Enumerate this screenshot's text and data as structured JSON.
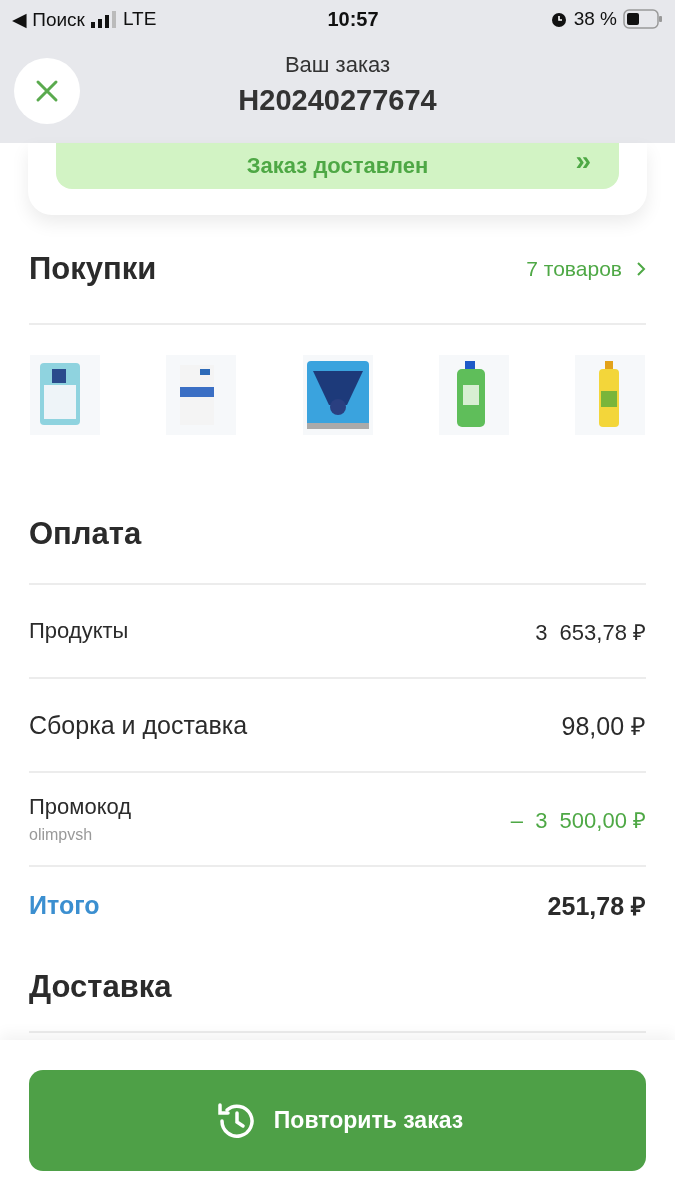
{
  "status_bar": {
    "back_label": "◀ Поиск",
    "network": "LTE",
    "time": "10:57",
    "battery": "38 %"
  },
  "header": {
    "title": "Ваш заказ",
    "order_number": "H20240277674"
  },
  "order_status": {
    "label": "Заказ доставлен",
    "arrow": "»"
  },
  "purchases": {
    "title": "Покупки",
    "count_link": "7 товаров",
    "products": [
      {
        "kind": "bag"
      },
      {
        "kind": "box"
      },
      {
        "kind": "can"
      },
      {
        "kind": "bottle"
      },
      {
        "kind": "oil"
      }
    ]
  },
  "payment": {
    "title": "Оплата",
    "rows": [
      {
        "kind": "normal",
        "label": "Продукты",
        "amount": "3  653,78 ₽"
      },
      {
        "kind": "large",
        "label": "Сборка и доставка",
        "amount": "98,00 ₽"
      },
      {
        "kind": "discount",
        "label": "Промокод",
        "sublabel": "olimpvsh",
        "amount": "–  3  500,00 ₽"
      },
      {
        "kind": "total",
        "label": "Итого",
        "amount": "251,78 ₽"
      }
    ]
  },
  "delivery": {
    "title": "Доставка"
  },
  "repeat_button": {
    "label": "Повторить заказ"
  }
}
